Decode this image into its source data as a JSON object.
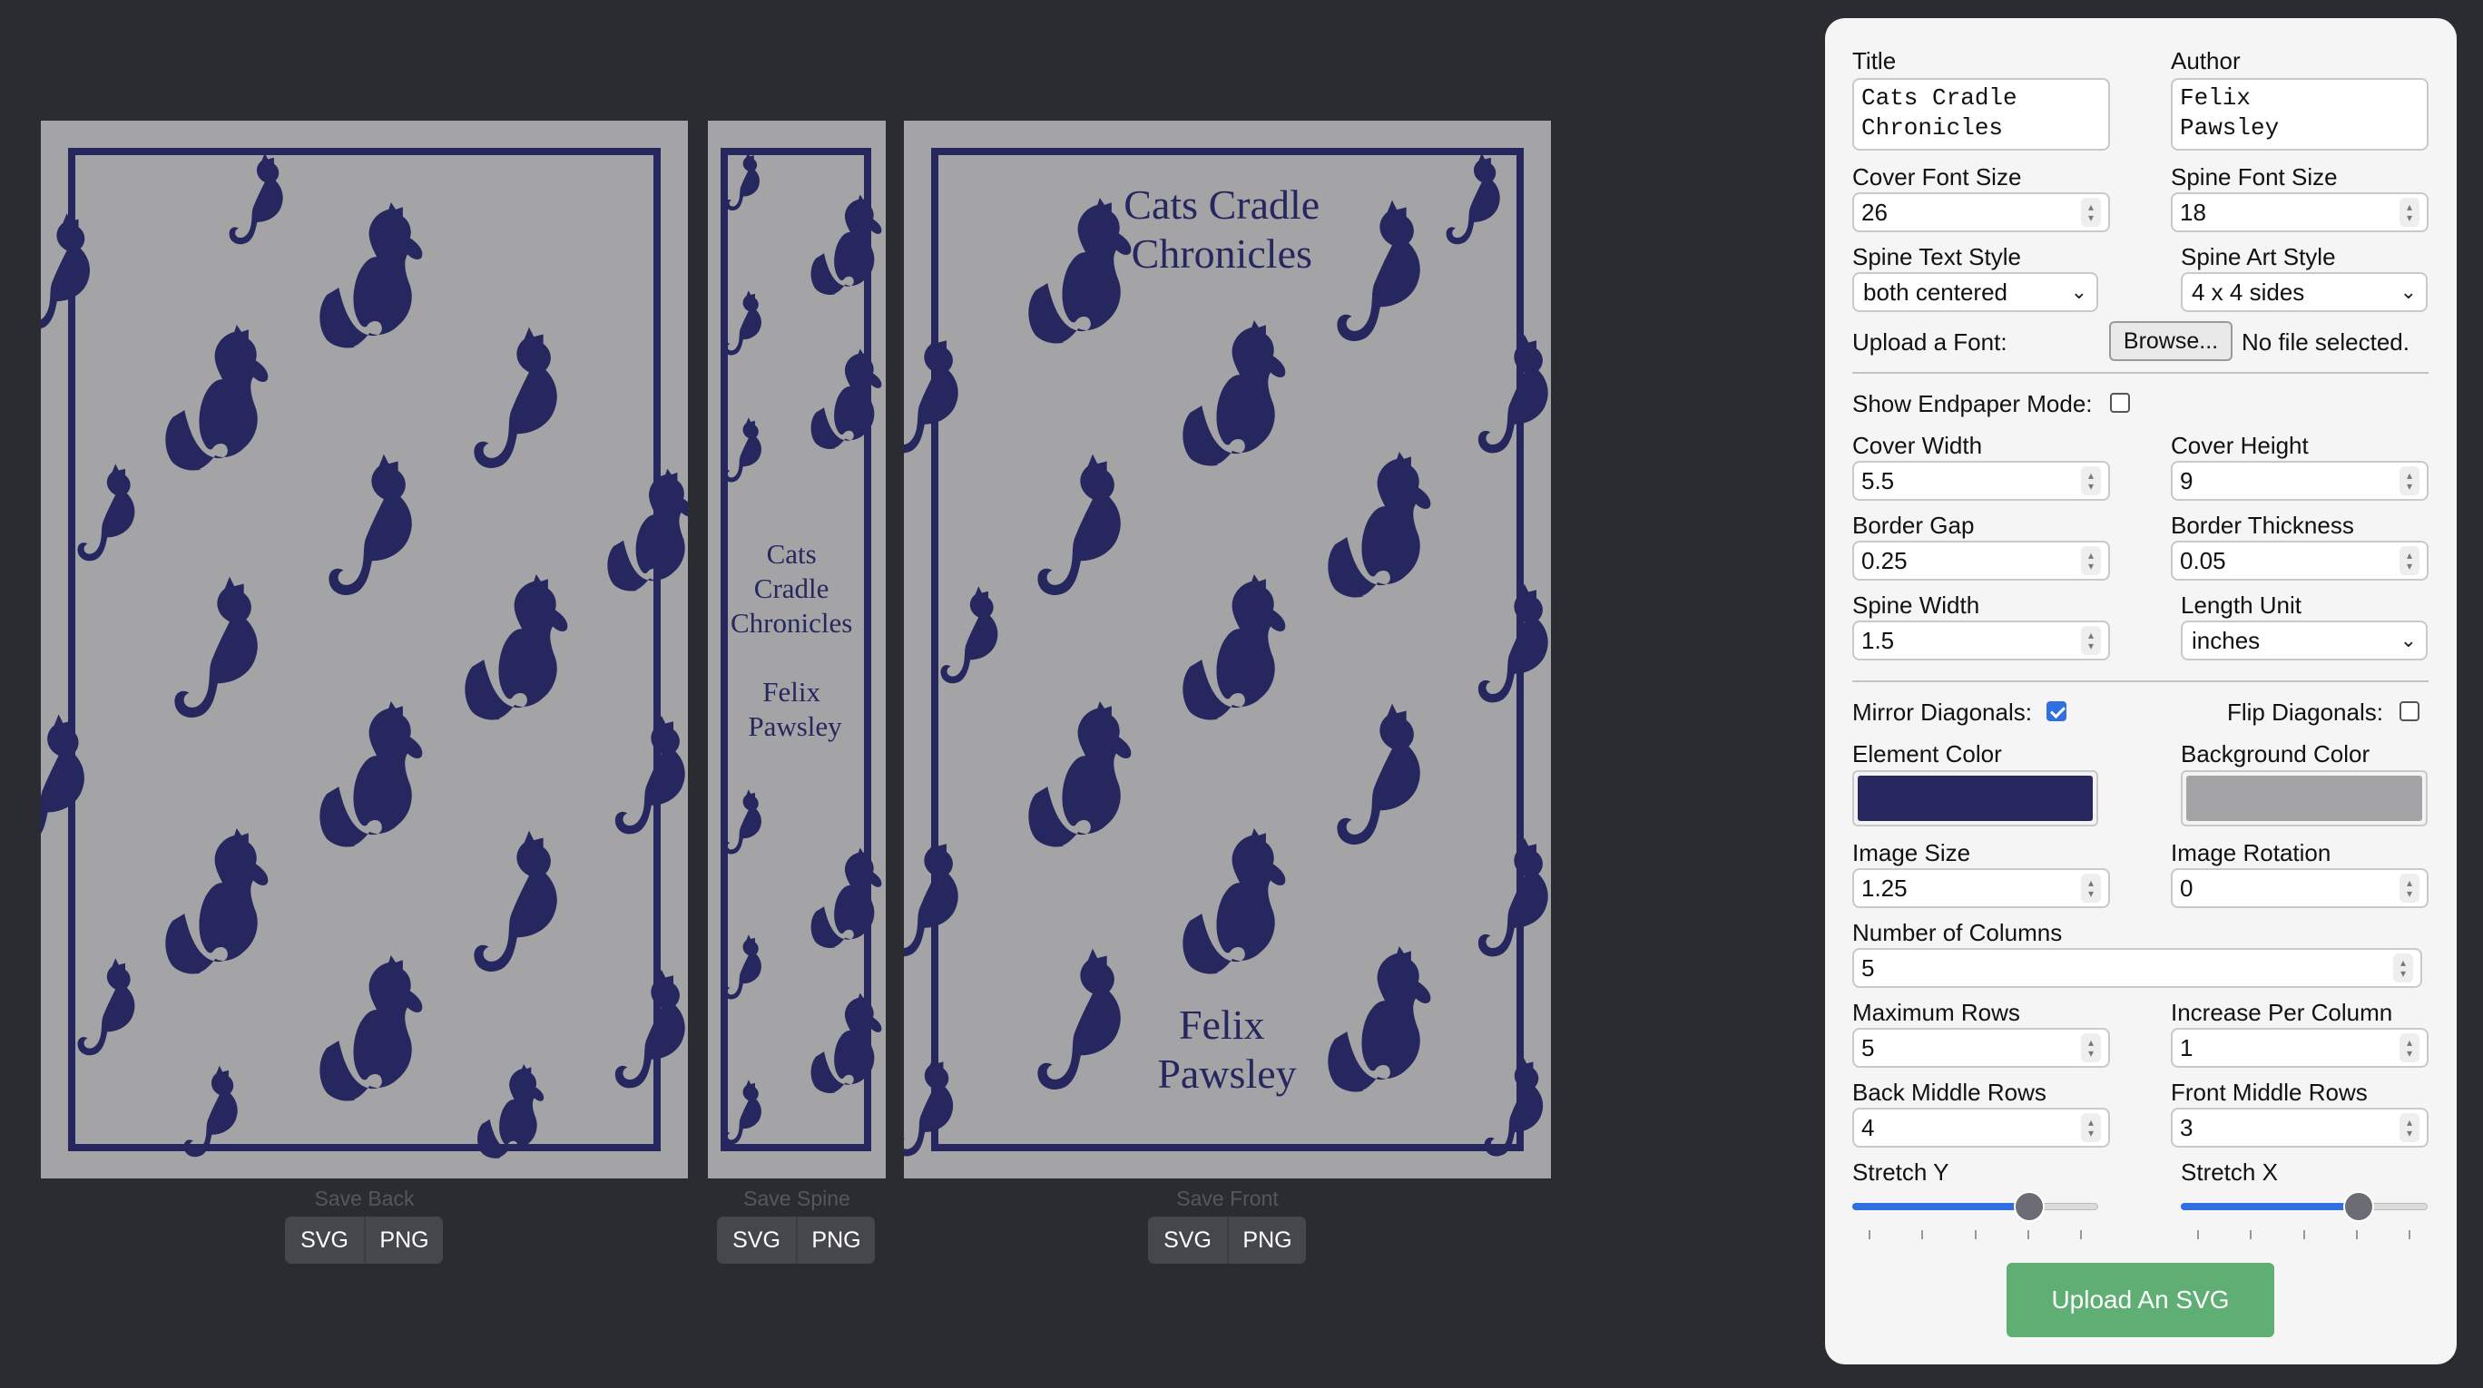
{
  "covers": {
    "back": {
      "save_label": "Save Back"
    },
    "spine": {
      "save_label": "Save Spine",
      "title_lines": [
        "Cats",
        "Cradle",
        "Chronicles"
      ],
      "author_lines": [
        "Felix",
        "Pawsley"
      ]
    },
    "front": {
      "save_label": "Save Front",
      "title_lines": [
        "Cats Cradle",
        "Chronicles"
      ],
      "author_lines": [
        "Felix",
        "Pawsley"
      ]
    },
    "buttons": {
      "svg": "SVG",
      "png": "PNG"
    }
  },
  "controls": {
    "title": {
      "label": "Title",
      "value": "Cats Cradle\nChronicles"
    },
    "author": {
      "label": "Author",
      "value": "Felix\nPawsley"
    },
    "cover_font_size": {
      "label": "Cover Font Size",
      "value": "26"
    },
    "spine_font_size": {
      "label": "Spine Font Size",
      "value": "18"
    },
    "spine_text_style": {
      "label": "Spine Text Style",
      "value": "both centered"
    },
    "spine_art_style": {
      "label": "Spine Art Style",
      "value": "4 x 4 sides"
    },
    "upload_font": {
      "label": "Upload a Font:",
      "button": "Browse...",
      "status": "No file selected."
    },
    "endpaper_mode": {
      "label": "Show Endpaper Mode:",
      "checked": false
    },
    "cover_width": {
      "label": "Cover Width",
      "value": "5.5"
    },
    "cover_height": {
      "label": "Cover Height",
      "value": "9"
    },
    "border_gap": {
      "label": "Border Gap",
      "value": "0.25"
    },
    "border_thickness": {
      "label": "Border Thickness",
      "value": "0.05"
    },
    "spine_width": {
      "label": "Spine Width",
      "value": "1.5"
    },
    "length_unit": {
      "label": "Length Unit",
      "value": "inches"
    },
    "mirror_diagonals": {
      "label": "Mirror Diagonals:",
      "checked": true
    },
    "flip_diagonals": {
      "label": "Flip Diagonals:",
      "checked": false
    },
    "element_color": {
      "label": "Element Color",
      "value": "#25275e"
    },
    "background_color": {
      "label": "Background Color",
      "value": "#a4a4a6"
    },
    "image_size": {
      "label": "Image Size",
      "value": "1.25"
    },
    "image_rotation": {
      "label": "Image Rotation",
      "value": "0"
    },
    "number_of_columns": {
      "label": "Number of Columns",
      "value": "5"
    },
    "maximum_rows": {
      "label": "Maximum Rows",
      "value": "5"
    },
    "increase_per_column": {
      "label": "Increase Per Column",
      "value": "1"
    },
    "back_middle_rows": {
      "label": "Back Middle Rows",
      "value": "4"
    },
    "front_middle_rows": {
      "label": "Front Middle Rows",
      "value": "3"
    },
    "stretch_y": {
      "label": "Stretch Y",
      "fraction": 0.72
    },
    "stretch_x": {
      "label": "Stretch X",
      "fraction": 0.72
    },
    "upload_svg": {
      "label": "Upload An SVG"
    }
  },
  "colors": {
    "element": "#25275e",
    "background": "#a4a4a6",
    "page": "#2a2c31",
    "accent": "#2f6fe0"
  },
  "icons": [
    "cat-icon",
    "chevron-down-icon",
    "spinner-icon",
    "checkmark-icon"
  ]
}
